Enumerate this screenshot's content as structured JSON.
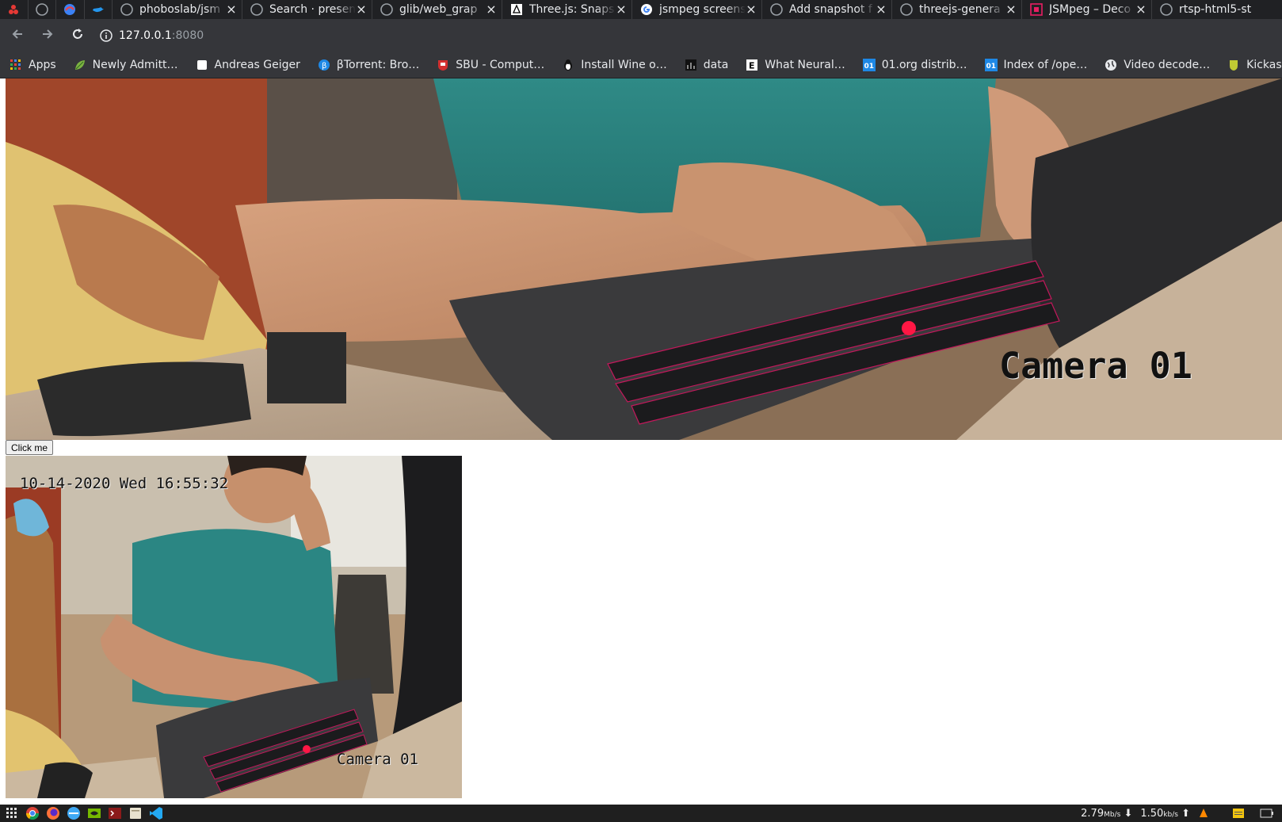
{
  "browser": {
    "pinned_tabs": [
      {
        "icon": "red-app-icon"
      },
      {
        "icon": "github-icon"
      },
      {
        "icon": "firefox-like-icon"
      },
      {
        "icon": "docker-icon"
      }
    ],
    "tabs": [
      {
        "label": "phoboslab/jsm",
        "icon": "github-icon"
      },
      {
        "label": "Search · presen",
        "icon": "github-icon"
      },
      {
        "label": "glib/web_grap",
        "icon": "github-icon"
      },
      {
        "label": "Three.js: Snaps",
        "icon": "threejs-icon"
      },
      {
        "label": "jsmpeg screens",
        "icon": "google-icon"
      },
      {
        "label": "Add snapshot f",
        "icon": "github-icon"
      },
      {
        "label": "threejs-genera",
        "icon": "github-icon"
      },
      {
        "label": "JSMpeg – Deco",
        "icon": "jsmpeg-icon"
      },
      {
        "label": "rtsp-html5-st",
        "icon": "github-icon"
      }
    ],
    "tab_close_glyph": "×",
    "address": {
      "host": "127.0.0.1",
      "port": ":8080"
    },
    "bookmarks": [
      {
        "label": "Apps",
        "icon": "apps-grid-icon"
      },
      {
        "label": "Newly Admitt…",
        "icon": "leaf-icon"
      },
      {
        "label": "Andreas Geiger",
        "icon": "white-square-icon"
      },
      {
        "label": "βTorrent: Bro…",
        "icon": "btorrent-icon"
      },
      {
        "label": "SBU - Comput…",
        "icon": "sbu-shield-icon"
      },
      {
        "label": "Install Wine o…",
        "icon": "penguin-icon"
      },
      {
        "label": "data",
        "icon": "data-icon"
      },
      {
        "label": "What Neural…",
        "icon": "e-letter-icon"
      },
      {
        "label": "01.org distrib…",
        "icon": "01org-icon"
      },
      {
        "label": "Index of /ope…",
        "icon": "01org-icon"
      },
      {
        "label": "Video decode…",
        "icon": "globe-icon"
      },
      {
        "label": "Kickasst",
        "icon": "kickass-icon"
      }
    ]
  },
  "page": {
    "big_camera": {
      "label": "Camera 01"
    },
    "button_label": "Click me",
    "small_camera": {
      "timestamp": "10-14-2020 Wed 16:55:32",
      "label": "Camera 01"
    }
  },
  "taskbar": {
    "apps": [
      "app-grid-icon",
      "chrome-icon",
      "firefox-icon",
      "steam-like-icon",
      "nvidia-icon",
      "terminal-icon",
      "files-icon",
      "vscode-icon"
    ],
    "download_rate": "2.79",
    "download_unit": "Mb/s",
    "upload_rate": "1.50",
    "upload_unit": "kb/s",
    "down_arrow": "⬇",
    "up_arrow": "⬆"
  }
}
